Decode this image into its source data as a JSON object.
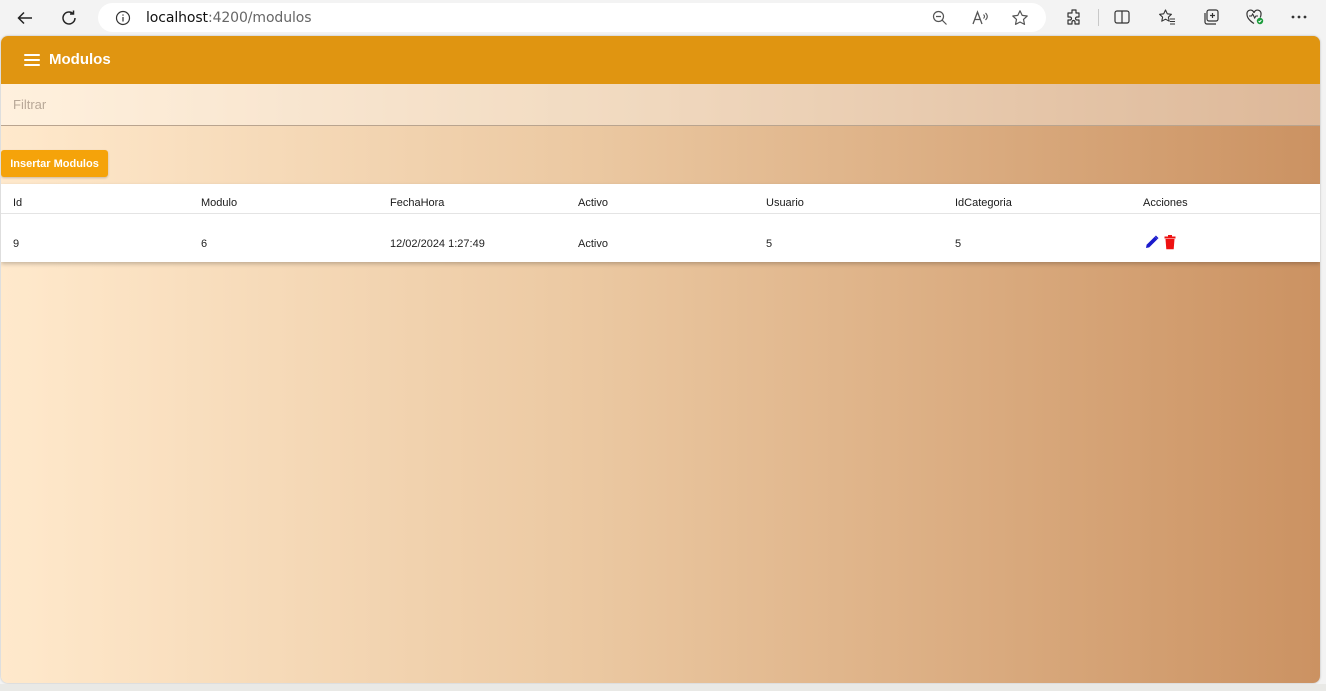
{
  "browser": {
    "url_host": "localhost",
    "url_rest": ":4200/modulos",
    "colors": {
      "chrome_bg": "#f3f3f3"
    }
  },
  "toolbar": {
    "title": "Modulos",
    "color": "#e09511"
  },
  "filter": {
    "placeholder": "Filtrar",
    "value": ""
  },
  "insert_button": {
    "label": "Insertar Modulos",
    "color": "#f5a30a"
  },
  "table": {
    "columns": [
      "Id",
      "Modulo",
      "FechaHora",
      "Activo",
      "Usuario",
      "IdCategoria",
      "Acciones"
    ],
    "rows": [
      {
        "id": "9",
        "modulo": "6",
        "fechahora": "12/02/2024 1:27:49",
        "activo": "Activo",
        "usuario": "5",
        "idcategoria": "5"
      }
    ],
    "action_icons": [
      "edit-icon",
      "delete-icon"
    ],
    "colors": {
      "edit": "#1a1acc",
      "delete": "#ee1111"
    }
  }
}
